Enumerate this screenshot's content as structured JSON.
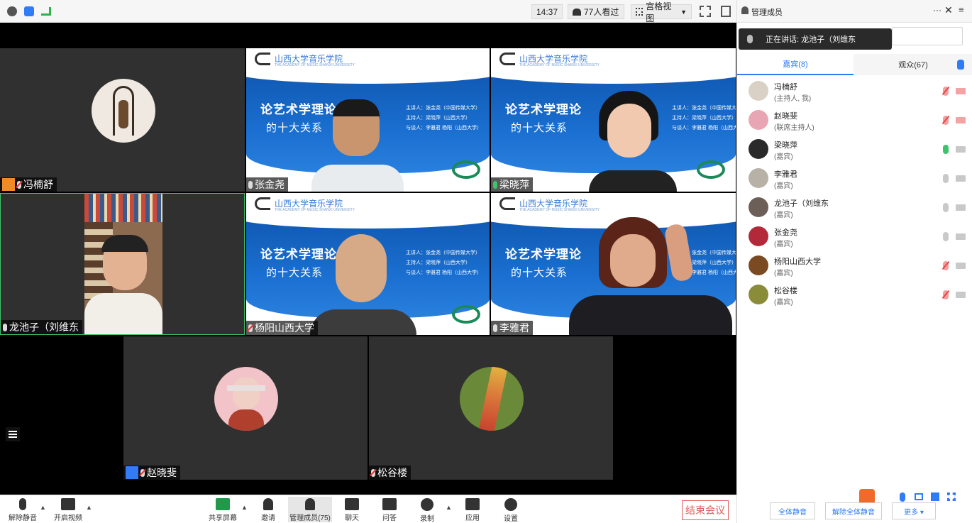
{
  "topbar": {
    "time": "14:37",
    "attendees": "77人看过",
    "view_mode": "宫格视图"
  },
  "tiles": [
    {
      "name": "冯楠舒",
      "host": true
    },
    {
      "name": "张金尧"
    },
    {
      "name": "梁晓萍"
    },
    {
      "name": "龙池子（刘维东"
    },
    {
      "name": "杨阳山西大学"
    },
    {
      "name": "李雅君"
    },
    {
      "name": "赵晓斐",
      "blue": true
    },
    {
      "name": "松谷楼"
    }
  ],
  "slide": {
    "school": "山西大学音乐学院",
    "school_en": "THE ACADEMY OF MUSIC SHANXI UNIVERSITY",
    "title1": "论艺术学理论",
    "title2": "的十大关系",
    "info1": "主讲人：张金尧（中国传媒大学）",
    "info2": "主持人：梁晓萍（山西大学）",
    "info3": "与谈人：李雅君 杨阳（山西大学）"
  },
  "toolbar": {
    "mute": "解除静音",
    "video": "开启视频",
    "share": "共享屏幕",
    "invite": "邀请",
    "members": "管理成员(75)",
    "chat": "聊天",
    "qa": "问答",
    "record": "录制",
    "apps": "应用",
    "settings": "设置",
    "end": "结束会议"
  },
  "panel": {
    "title": "管理成员",
    "speaking": "正在讲话: 龙池子（刘维东",
    "tab_guests": "嘉宾(8)",
    "tab_audience": "观众(67)",
    "members": [
      {
        "name": "冯楠舒",
        "role": "(主持人, 我)"
      },
      {
        "name": "赵晓斐",
        "role": "(联席主持人)"
      },
      {
        "name": "梁晓萍",
        "role": "(嘉宾)"
      },
      {
        "name": "李雅君",
        "role": "(嘉宾)"
      },
      {
        "name": "龙池子（刘维东",
        "role": "(嘉宾)"
      },
      {
        "name": "张金尧",
        "role": "(嘉宾)"
      },
      {
        "name": "杨阳山西大学",
        "role": "(嘉宾)"
      },
      {
        "name": "松谷楼",
        "role": "(嘉宾)"
      }
    ],
    "mute_all": "全体静音",
    "unmute_all": "解除全体静音",
    "more": "更多 ▾"
  }
}
